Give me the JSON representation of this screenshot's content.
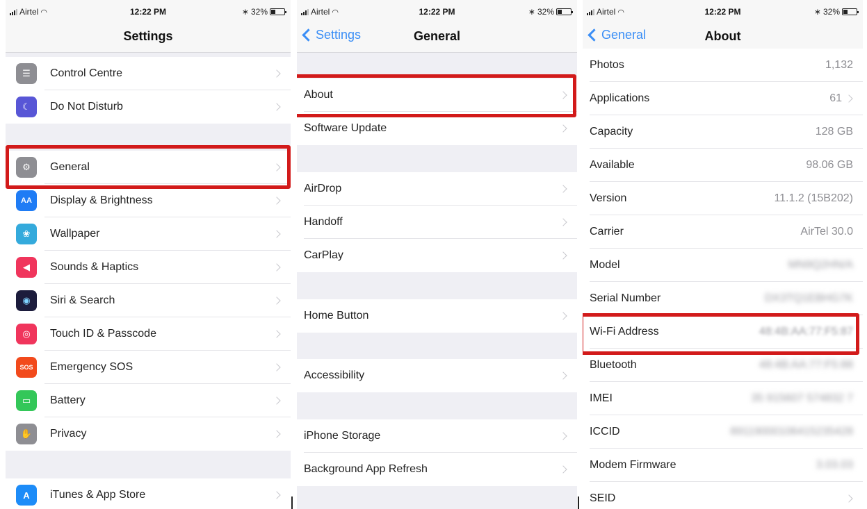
{
  "status": {
    "carrier": "Airtel",
    "time": "12:22 PM",
    "battery": "32%"
  },
  "colors": {
    "accent": "#3a8ef6",
    "highlight": "#d21a1a",
    "chevron": "#c7c7cc"
  },
  "panel1": {
    "title": "Settings",
    "rows": [
      {
        "label": "Control Centre",
        "icon": "control-centre-icon",
        "color": "#8e8e93"
      },
      {
        "label": "Do Not Disturb",
        "icon": "moon-icon",
        "color": "#5856d6"
      },
      {
        "label": "General",
        "icon": "gear-icon",
        "color": "#8e8e93"
      },
      {
        "label": "Display & Brightness",
        "icon": "aa-icon",
        "color": "#1f7cf5"
      },
      {
        "label": "Wallpaper",
        "icon": "flower-icon",
        "color": "#34aadc"
      },
      {
        "label": "Sounds & Haptics",
        "icon": "speaker-icon",
        "color": "#f0355c"
      },
      {
        "label": "Siri & Search",
        "icon": "siri-icon",
        "color": "#1c1c3c"
      },
      {
        "label": "Touch ID & Passcode",
        "icon": "fingerprint-icon",
        "color": "#f0355c"
      },
      {
        "label": "Emergency SOS",
        "icon": "sos-icon",
        "icon_text": "SOS",
        "color": "#f24a1c"
      },
      {
        "label": "Battery",
        "icon": "battery-icon",
        "color": "#34c759"
      },
      {
        "label": "Privacy",
        "icon": "hand-icon",
        "color": "#8e8e93"
      },
      {
        "label": "iTunes & App Store",
        "icon": "app-store-icon",
        "color": "#1d8cf8"
      }
    ]
  },
  "panel2": {
    "back": "Settings",
    "title": "General",
    "rows": [
      {
        "label": "About"
      },
      {
        "label": "Software Update"
      },
      {
        "label": "AirDrop"
      },
      {
        "label": "Handoff"
      },
      {
        "label": "CarPlay"
      },
      {
        "label": "Home Button"
      },
      {
        "label": "Accessibility"
      },
      {
        "label": "iPhone Storage"
      },
      {
        "label": "Background App Refresh"
      }
    ]
  },
  "panel3": {
    "back": "General",
    "title": "About",
    "rows": [
      {
        "label": "Photos",
        "value": "1,132"
      },
      {
        "label": "Applications",
        "value": "61"
      },
      {
        "label": "Capacity",
        "value": "128 GB"
      },
      {
        "label": "Available",
        "value": "98.06 GB"
      },
      {
        "label": "Version",
        "value": "11.1.2 (15B202)"
      },
      {
        "label": "Carrier",
        "value": "AirTel 30.0"
      },
      {
        "label": "Model",
        "value": "MN9Q2HN/A"
      },
      {
        "label": "Serial Number",
        "value": "DX3TQ1EBHG7K"
      },
      {
        "label": "Wi-Fi Address",
        "value": "48:4B:AA:77:F5:87"
      },
      {
        "label": "Bluetooth",
        "value": "48:4B:AA:77:F5:88"
      },
      {
        "label": "IMEI",
        "value": "35 915607 574832 7"
      },
      {
        "label": "ICCID",
        "value": "89119000106415235428"
      },
      {
        "label": "Modem Firmware",
        "value": "3.03.03"
      },
      {
        "label": "SEID",
        "value": ""
      }
    ]
  }
}
